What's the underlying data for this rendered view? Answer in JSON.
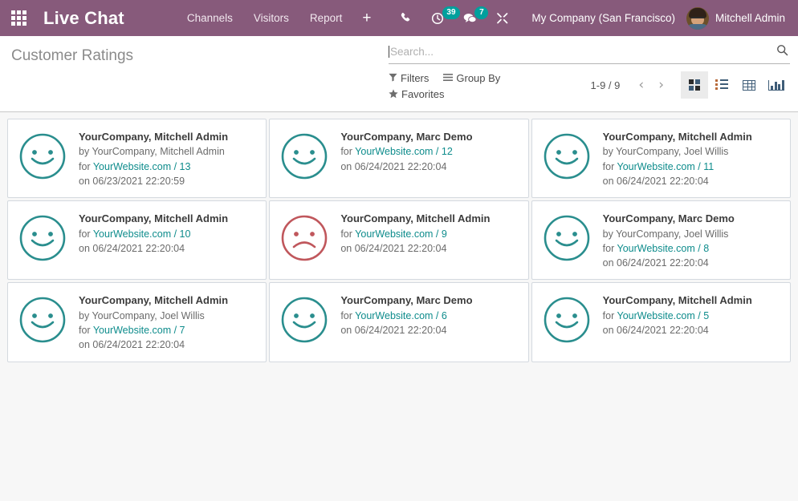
{
  "navbar": {
    "apps_icon": "apps-grid-icon",
    "brand": "Live Chat",
    "menus": [
      {
        "label": "Channels"
      },
      {
        "label": "Visitors"
      },
      {
        "label": "Report"
      }
    ],
    "plus_label": "+",
    "icons": [
      {
        "name": "phone-icon",
        "glyph": "✆",
        "badge": null
      },
      {
        "name": "activity-clock-icon",
        "glyph": "◴",
        "badge": "39"
      },
      {
        "name": "messages-icon",
        "glyph": "◕",
        "badge": "7"
      },
      {
        "name": "tools-icon",
        "glyph": "✂",
        "badge": null
      }
    ],
    "company": "My Company (San Francisco)",
    "username": "Mitchell Admin",
    "bg_color": "#875a7b",
    "badge_color": "#00a09d"
  },
  "control_panel": {
    "breadcrumb": "Customer Ratings",
    "search": {
      "placeholder": "Search...",
      "value": "",
      "icon": "search-icon"
    },
    "filters": [
      {
        "name": "filters",
        "label": "Filters",
        "icon": "funnel-icon"
      },
      {
        "name": "group-by",
        "label": "Group By",
        "icon": "bars-icon"
      },
      {
        "name": "favorites",
        "label": "Favorites",
        "icon": "star-icon"
      }
    ],
    "pager": {
      "count": "1-9 / 9",
      "prev": "‹",
      "next": "›"
    },
    "views": [
      {
        "name": "kanban",
        "icon": "kanban-icon",
        "active": true
      },
      {
        "name": "list",
        "icon": "list-icon",
        "active": false
      },
      {
        "name": "pivot",
        "icon": "pivot-table-icon",
        "active": false
      },
      {
        "name": "graph",
        "icon": "bar-chart-icon",
        "active": false
      }
    ]
  },
  "kanban": {
    "smiley_colors": {
      "happy": "#2a8e8e",
      "sad": "#c0575c"
    },
    "cards": [
      {
        "title": "YourCompany, Mitchell Admin",
        "by": "by YourCompany, Mitchell Admin",
        "for_prefix": "for ",
        "for_link": "YourWebsite.com",
        "for_sep": " / ",
        "for_id": "13",
        "on": "on 06/23/2021 22:20:59",
        "mood": "happy"
      },
      {
        "title": "YourCompany, Marc Demo",
        "by": "",
        "for_prefix": "for ",
        "for_link": "YourWebsite.com",
        "for_sep": " / ",
        "for_id": "12",
        "on": "on 06/24/2021 22:20:04",
        "mood": "happy"
      },
      {
        "title": "YourCompany, Mitchell Admin",
        "by": "by YourCompany, Joel Willis",
        "for_prefix": "for ",
        "for_link": "YourWebsite.com",
        "for_sep": " / ",
        "for_id": "11",
        "on": "on 06/24/2021 22:20:04",
        "mood": "happy"
      },
      {
        "title": "YourCompany, Mitchell Admin",
        "by": "",
        "for_prefix": "for ",
        "for_link": "YourWebsite.com",
        "for_sep": " / ",
        "for_id": "10",
        "on": "on 06/24/2021 22:20:04",
        "mood": "happy"
      },
      {
        "title": "YourCompany, Mitchell Admin",
        "by": "",
        "for_prefix": "for ",
        "for_link": "YourWebsite.com",
        "for_sep": " / ",
        "for_id": "9",
        "on": "on 06/24/2021 22:20:04",
        "mood": "sad"
      },
      {
        "title": "YourCompany, Marc Demo",
        "by": "by YourCompany, Joel Willis",
        "for_prefix": "for ",
        "for_link": "YourWebsite.com",
        "for_sep": " / ",
        "for_id": "8",
        "on": "on 06/24/2021 22:20:04",
        "mood": "happy"
      },
      {
        "title": "YourCompany, Mitchell Admin",
        "by": "by YourCompany, Joel Willis",
        "for_prefix": "for ",
        "for_link": "YourWebsite.com",
        "for_sep": " / ",
        "for_id": "7",
        "on": "on 06/24/2021 22:20:04",
        "mood": "happy"
      },
      {
        "title": "YourCompany, Marc Demo",
        "by": "",
        "for_prefix": "for ",
        "for_link": "YourWebsite.com",
        "for_sep": " / ",
        "for_id": "6",
        "on": "on 06/24/2021 22:20:04",
        "mood": "happy"
      },
      {
        "title": "YourCompany, Mitchell Admin",
        "by": "",
        "for_prefix": "for ",
        "for_link": "YourWebsite.com",
        "for_sep": " / ",
        "for_id": "5",
        "on": "on 06/24/2021 22:20:04",
        "mood": "happy"
      }
    ]
  }
}
